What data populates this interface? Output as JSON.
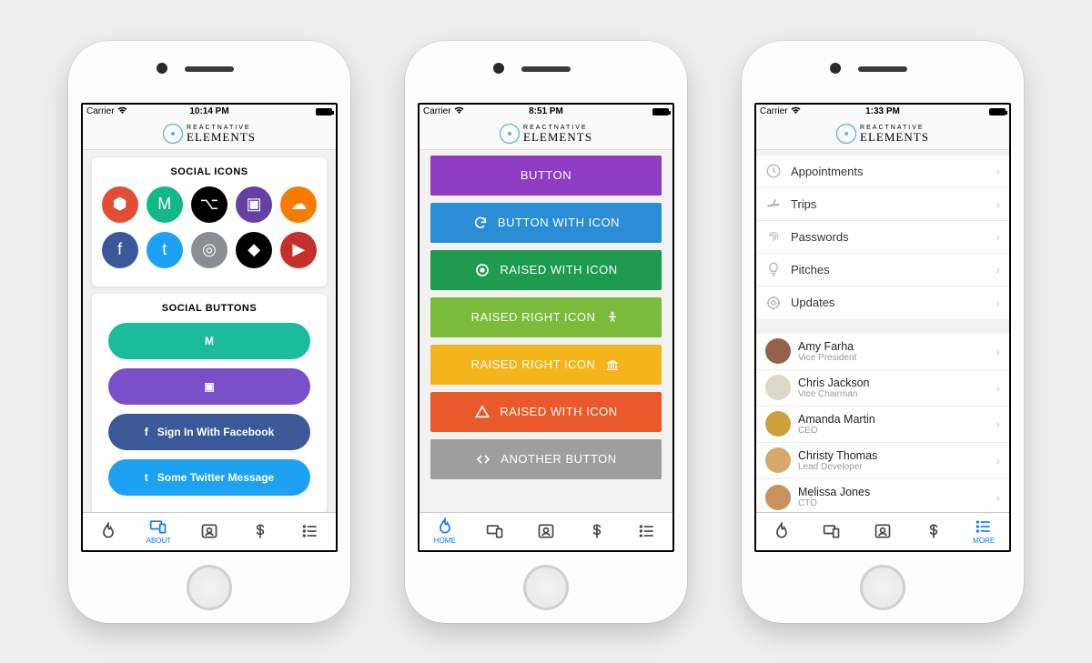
{
  "status": {
    "carrier": "Carrier",
    "times": [
      "10:14 PM",
      "8:51 PM",
      "1:33 PM"
    ]
  },
  "header": {
    "line1": "REACTNATIVE",
    "line2": "ELEMENTS"
  },
  "tabs": {
    "items": [
      {
        "name": "home",
        "label": "HOME"
      },
      {
        "name": "about",
        "label": "ABOUT"
      },
      {
        "name": "contact",
        "label": ""
      },
      {
        "name": "pricing",
        "label": ""
      },
      {
        "name": "more",
        "label": "MORE"
      }
    ]
  },
  "phone1": {
    "section1_title": "SOCIAL ICONS",
    "icons": [
      {
        "name": "gitlab",
        "bg": "#e14e33",
        "glyph": "⬢"
      },
      {
        "name": "medium",
        "bg": "#12b886",
        "glyph": "M"
      },
      {
        "name": "github",
        "bg": "#000000",
        "glyph": "⌥"
      },
      {
        "name": "twitch",
        "bg": "#6441a4",
        "glyph": "▣"
      },
      {
        "name": "soundcloud",
        "bg": "#f57c00",
        "glyph": "☁"
      },
      {
        "name": "facebook",
        "bg": "#3b5998",
        "glyph": "f"
      },
      {
        "name": "twitter",
        "bg": "#1da1f2",
        "glyph": "t"
      },
      {
        "name": "instagram",
        "bg": "#8a8d93",
        "glyph": "◎"
      },
      {
        "name": "codepen",
        "bg": "#000000",
        "glyph": "◆"
      },
      {
        "name": "youtube",
        "bg": "#c4302b",
        "glyph": "▶"
      }
    ],
    "section2_title": "SOCIAL BUTTONS",
    "buttons": [
      {
        "name": "medium-button",
        "bg": "#1abc9c",
        "label": "",
        "glyph": "M"
      },
      {
        "name": "twitch-button",
        "bg": "#7b4fc9",
        "label": "",
        "glyph": "▣"
      },
      {
        "name": "facebook-signin",
        "bg": "#3b5998",
        "label": "Sign In With Facebook",
        "glyph": "f"
      },
      {
        "name": "twitter-message",
        "bg": "#1da1f2",
        "label": "Some Twitter Message",
        "glyph": "t"
      }
    ]
  },
  "phone2": {
    "buttons": [
      {
        "bg": "#8e3cc2",
        "label": "BUTTON",
        "icon": "",
        "icon_side": "none"
      },
      {
        "bg": "#2b8dd6",
        "label": "BUTTON WITH ICON",
        "icon": "refresh",
        "icon_side": "left"
      },
      {
        "bg": "#1e9b4f",
        "label": "RAISED WITH ICON",
        "icon": "record",
        "icon_side": "left"
      },
      {
        "bg": "#7abb3b",
        "label": "RAISED RIGHT ICON",
        "icon": "access",
        "icon_side": "right"
      },
      {
        "bg": "#f3b51b",
        "label": "RAISED RIGHT ICON",
        "icon": "bank",
        "icon_side": "right"
      },
      {
        "bg": "#e9592a",
        "label": "RAISED WITH ICON",
        "icon": "warning",
        "icon_side": "left"
      },
      {
        "bg": "#9e9e9e",
        "label": "ANOTHER BUTTON",
        "icon": "code",
        "icon_side": "left"
      }
    ]
  },
  "phone3": {
    "settings": [
      {
        "icon": "clock",
        "label": "Appointments"
      },
      {
        "icon": "plane",
        "label": "Trips"
      },
      {
        "icon": "fingerprint",
        "label": "Passwords"
      },
      {
        "icon": "bulb",
        "label": "Pitches"
      },
      {
        "icon": "target",
        "label": "Updates"
      }
    ],
    "people": [
      {
        "name": "Amy Farha",
        "role": "Vice President",
        "avatar_bg": "#94624b"
      },
      {
        "name": "Chris Jackson",
        "role": "Vice Chairman",
        "avatar_bg": "#ddd9c9"
      },
      {
        "name": "Amanda Martin",
        "role": "CEO",
        "avatar_bg": "#caa23b"
      },
      {
        "name": "Christy Thomas",
        "role": "Lead Developer",
        "avatar_bg": "#d6a96a"
      },
      {
        "name": "Melissa Jones",
        "role": "CTO",
        "avatar_bg": "#c9915e"
      }
    ]
  },
  "colors": {
    "active_tab": "#0b7bff"
  }
}
